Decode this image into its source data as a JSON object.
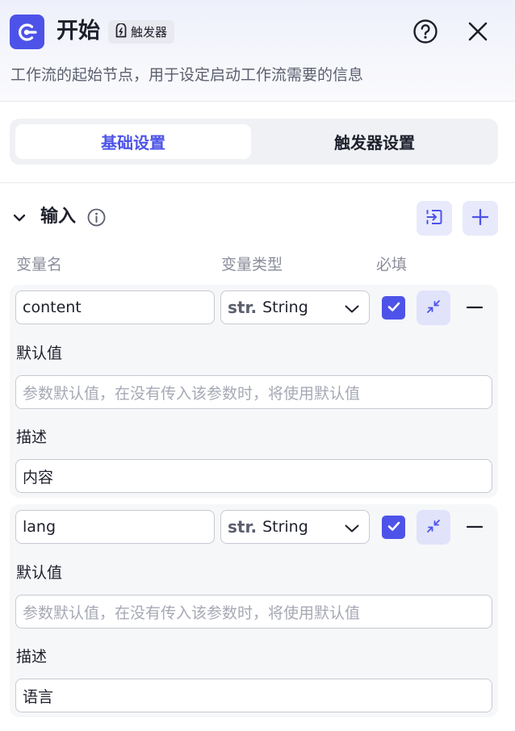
{
  "header": {
    "title": "开始",
    "badge": "触发器",
    "description": "工作流的起始节点，用于设定启动工作流需要的信息"
  },
  "tabs": [
    {
      "label": "基础设置",
      "active": true
    },
    {
      "label": "触发器设置",
      "active": false
    }
  ],
  "section": {
    "title": "输入",
    "columns": {
      "name": "变量名",
      "type": "变量类型",
      "required": "必填"
    }
  },
  "variables": [
    {
      "name": "content",
      "type_prefix": "str.",
      "type": "String",
      "required": true,
      "default_label": "默认值",
      "default_placeholder": "参数默认值，在没有传入该参数时，将使用默认值",
      "desc_label": "描述",
      "desc_value": "内容"
    },
    {
      "name": "lang",
      "type_prefix": "str.",
      "type": "String",
      "required": true,
      "default_label": "默认值",
      "default_placeholder": "参数默认值，在没有传入该参数时，将使用默认值",
      "desc_label": "描述",
      "desc_value": "语言"
    }
  ],
  "colors": {
    "accent": "#4d53e8",
    "accent_light": "#e8e9fb",
    "text": "#1d1f2b",
    "muted": "#8b8e9c"
  },
  "icons": {
    "app": "start-node-icon",
    "badge": "trigger-icon",
    "help": "help-circle-icon",
    "close": "close-icon",
    "chevron": "chevron-down-icon",
    "info": "info-icon",
    "import": "import-icon",
    "add": "plus-icon",
    "check": "check-icon",
    "collapse": "collapse-icon",
    "remove": "minus-icon"
  }
}
